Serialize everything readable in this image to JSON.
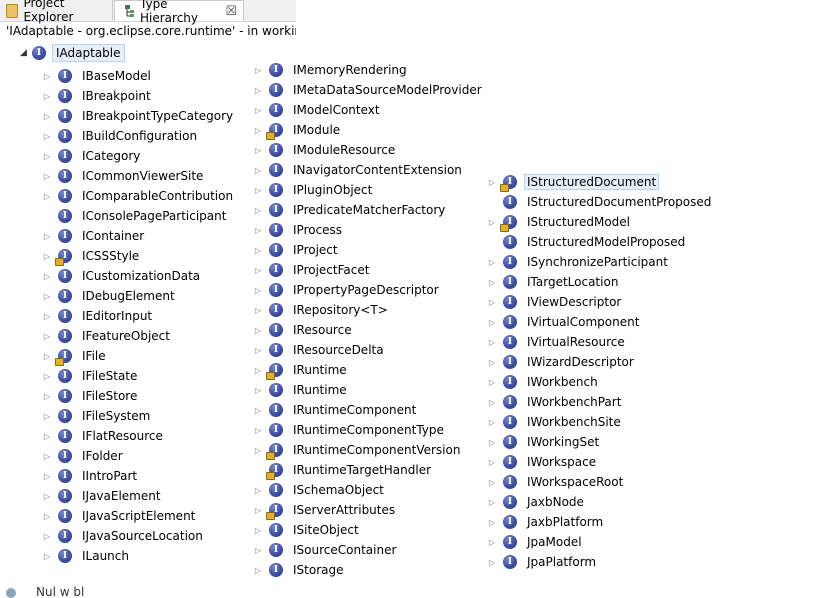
{
  "tabs": {
    "project_explorer": "Project Explorer",
    "type_hierarchy": "Type Hierarchy",
    "close_glyph": "☒"
  },
  "scope_text": "'IAdaptable - org.eclipse.core.runtime' - in workin",
  "root": {
    "label": "IAdaptable"
  },
  "columns": [
    [
      {
        "label": "IBaseModel",
        "expand": true,
        "lock": false
      },
      {
        "label": "IBreakpoint",
        "expand": true,
        "lock": false
      },
      {
        "label": "IBreakpointTypeCategory",
        "expand": true,
        "lock": false
      },
      {
        "label": "IBuildConfiguration",
        "expand": true,
        "lock": false
      },
      {
        "label": "ICategory",
        "expand": true,
        "lock": false
      },
      {
        "label": "ICommonViewerSite",
        "expand": true,
        "lock": false
      },
      {
        "label": "IComparableContribution",
        "expand": true,
        "lock": false
      },
      {
        "label": "IConsolePageParticipant",
        "expand": false,
        "lock": false
      },
      {
        "label": "IContainer",
        "expand": true,
        "lock": false
      },
      {
        "label": "ICSSStyle",
        "expand": true,
        "lock": true
      },
      {
        "label": "ICustomizationData",
        "expand": true,
        "lock": false
      },
      {
        "label": "IDebugElement",
        "expand": true,
        "lock": false
      },
      {
        "label": "IEditorInput",
        "expand": true,
        "lock": false
      },
      {
        "label": "IFeatureObject",
        "expand": true,
        "lock": false
      },
      {
        "label": "IFile",
        "expand": true,
        "lock": true
      },
      {
        "label": "IFileState",
        "expand": true,
        "lock": false
      },
      {
        "label": "IFileStore",
        "expand": true,
        "lock": false
      },
      {
        "label": "IFileSystem",
        "expand": true,
        "lock": false
      },
      {
        "label": "IFlatResource",
        "expand": true,
        "lock": false
      },
      {
        "label": "IFolder",
        "expand": true,
        "lock": false
      },
      {
        "label": "IIntroPart",
        "expand": true,
        "lock": false
      },
      {
        "label": "IJavaElement",
        "expand": true,
        "lock": false
      },
      {
        "label": "IJavaScriptElement",
        "expand": true,
        "lock": false
      },
      {
        "label": "IJavaSourceLocation",
        "expand": true,
        "lock": false
      },
      {
        "label": "ILaunch",
        "expand": true,
        "lock": false
      }
    ],
    [
      {
        "label": "IMemoryRendering",
        "expand": true,
        "lock": false
      },
      {
        "label": "IMetaDataSourceModelProvider",
        "expand": true,
        "lock": false
      },
      {
        "label": "IModelContext",
        "expand": true,
        "lock": false
      },
      {
        "label": "IModule",
        "expand": true,
        "lock": true
      },
      {
        "label": "IModuleResource",
        "expand": true,
        "lock": false
      },
      {
        "label": "INavigatorContentExtension",
        "expand": true,
        "lock": false
      },
      {
        "label": "IPluginObject",
        "expand": true,
        "lock": false
      },
      {
        "label": "IPredicateMatcherFactory",
        "expand": true,
        "lock": false
      },
      {
        "label": "IProcess",
        "expand": true,
        "lock": false
      },
      {
        "label": "IProject",
        "expand": true,
        "lock": false
      },
      {
        "label": "IProjectFacet",
        "expand": true,
        "lock": false
      },
      {
        "label": "IPropertyPageDescriptor",
        "expand": true,
        "lock": false
      },
      {
        "label": "IRepository<T>",
        "expand": true,
        "lock": false
      },
      {
        "label": "IResource",
        "expand": true,
        "lock": false
      },
      {
        "label": "IResourceDelta",
        "expand": true,
        "lock": false
      },
      {
        "label": "IRuntime",
        "expand": true,
        "lock": true
      },
      {
        "label": "IRuntime",
        "expand": true,
        "lock": false
      },
      {
        "label": "IRuntimeComponent",
        "expand": true,
        "lock": false
      },
      {
        "label": "IRuntimeComponentType",
        "expand": true,
        "lock": false
      },
      {
        "label": "IRuntimeComponentVersion",
        "expand": true,
        "lock": true
      },
      {
        "label": "IRuntimeTargetHandler",
        "expand": false,
        "lock": true
      },
      {
        "label": "ISchemaObject",
        "expand": true,
        "lock": false
      },
      {
        "label": "IServerAttributes",
        "expand": true,
        "lock": true
      },
      {
        "label": "ISiteObject",
        "expand": true,
        "lock": false
      },
      {
        "label": "ISourceContainer",
        "expand": true,
        "lock": false
      },
      {
        "label": "IStorage",
        "expand": true,
        "lock": false
      }
    ],
    [
      {
        "label": "IStructuredDocument",
        "expand": true,
        "lock": true,
        "selected": true
      },
      {
        "label": "IStructuredDocumentProposed",
        "expand": false,
        "lock": false
      },
      {
        "label": "IStructuredModel",
        "expand": true,
        "lock": true
      },
      {
        "label": "IStructuredModelProposed",
        "expand": false,
        "lock": false
      },
      {
        "label": "ISynchronizeParticipant",
        "expand": true,
        "lock": false
      },
      {
        "label": "ITargetLocation",
        "expand": true,
        "lock": false
      },
      {
        "label": "IViewDescriptor",
        "expand": true,
        "lock": false
      },
      {
        "label": "IVirtualComponent",
        "expand": true,
        "lock": false
      },
      {
        "label": "IVirtualResource",
        "expand": true,
        "lock": false
      },
      {
        "label": "IWizardDescriptor",
        "expand": true,
        "lock": false
      },
      {
        "label": "IWorkbench",
        "expand": true,
        "lock": false
      },
      {
        "label": "IWorkbenchPart",
        "expand": true,
        "lock": false
      },
      {
        "label": "IWorkbenchSite",
        "expand": true,
        "lock": false
      },
      {
        "label": "IWorkingSet",
        "expand": true,
        "lock": false
      },
      {
        "label": "IWorkspace",
        "expand": true,
        "lock": false
      },
      {
        "label": "IWorkspaceRoot",
        "expand": true,
        "lock": false
      },
      {
        "label": "JaxbNode",
        "expand": true,
        "lock": false
      },
      {
        "label": "JaxbPlatform",
        "expand": true,
        "lock": false
      },
      {
        "label": "JpaModel",
        "expand": true,
        "lock": false
      },
      {
        "label": "JpaPlatform",
        "expand": true,
        "lock": false
      }
    ]
  ],
  "icon_names": {
    "interface": "interface-icon",
    "expand": "expand-triangle-icon"
  },
  "bottom_partial_text": "Nul w   bl"
}
